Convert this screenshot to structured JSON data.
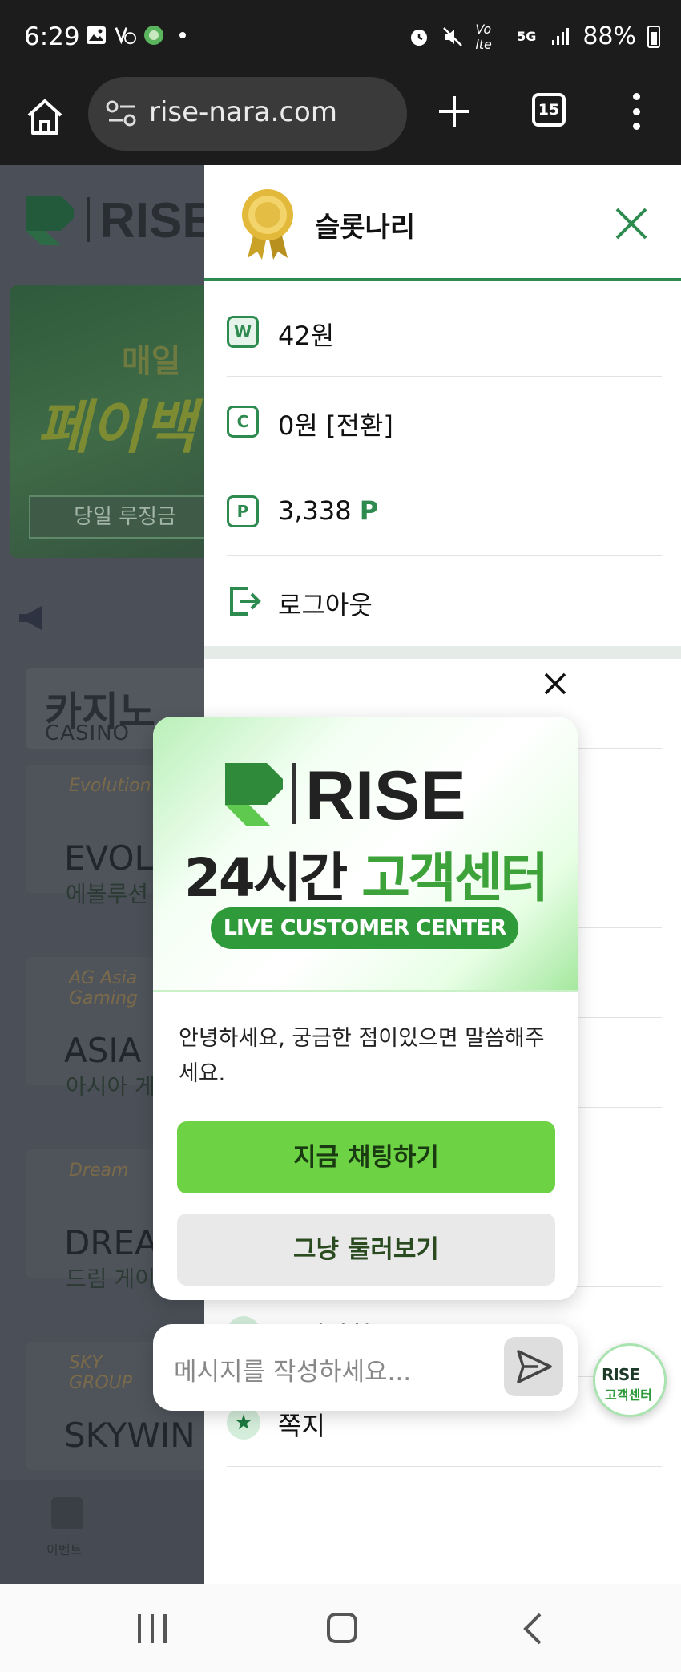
{
  "status_bar": {
    "time": "6:29",
    "battery": "88%",
    "network": "5G",
    "icons": [
      "gallery-icon",
      "v3-icon",
      "kakao-icon",
      "dot-icon",
      "alarm-icon",
      "mute-icon",
      "volte-icon",
      "5g-icon",
      "signal-icon",
      "battery-icon"
    ]
  },
  "browser": {
    "url": "rise-nara.com",
    "tab_count": "15"
  },
  "background_page": {
    "banner_line1": "매일 ",
    "banner_line2": "페이백",
    "banner_button": "당일 루징금",
    "section_title": "카지노",
    "section_subtitle": "CASINO",
    "cards": [
      {
        "brand": "Evolution",
        "name": "EVOLU",
        "korean": "에볼루션"
      },
      {
        "brand": "AG Asia Gaming",
        "name": "ASIA",
        "korean": "아시아 게"
      },
      {
        "brand": "Dream",
        "name": "DREA",
        "korean": "드림 게이밍"
      },
      {
        "brand": "SKY GROUP",
        "name": "SKYWIN",
        "korean": ""
      }
    ],
    "nav_label": "이벤트"
  },
  "panel": {
    "username": "슬롯나리",
    "wallet": {
      "icon_letter": "W",
      "value": "42원"
    },
    "casino": {
      "icon_letter": "C",
      "value": "0원 [전환]"
    },
    "points": {
      "icon_letter": "P",
      "value": "3,338",
      "unit": "P"
    },
    "logout": "로그아웃",
    "list": [
      {
        "label": "공지사항"
      },
      {
        "label": "쪽지"
      }
    ]
  },
  "chat": {
    "brand": "RISE",
    "title_black": "24시간 ",
    "title_green": "고객센터",
    "pill": "LIVE CUSTOMER CENTER",
    "message": "안녕하세요, 궁금한 점이있으면 말씀해주세요.",
    "primary_button": "지금 채팅하기",
    "secondary_button": "그냥 둘러보기",
    "input_placeholder": "메시지를 작성하세요...",
    "fab_line1": "RISE",
    "fab_line2": "고객센터"
  },
  "colors": {
    "accent_green": "#2e8b4f",
    "chat_green": "#6dd244",
    "panel_bg": "#ffffff"
  }
}
